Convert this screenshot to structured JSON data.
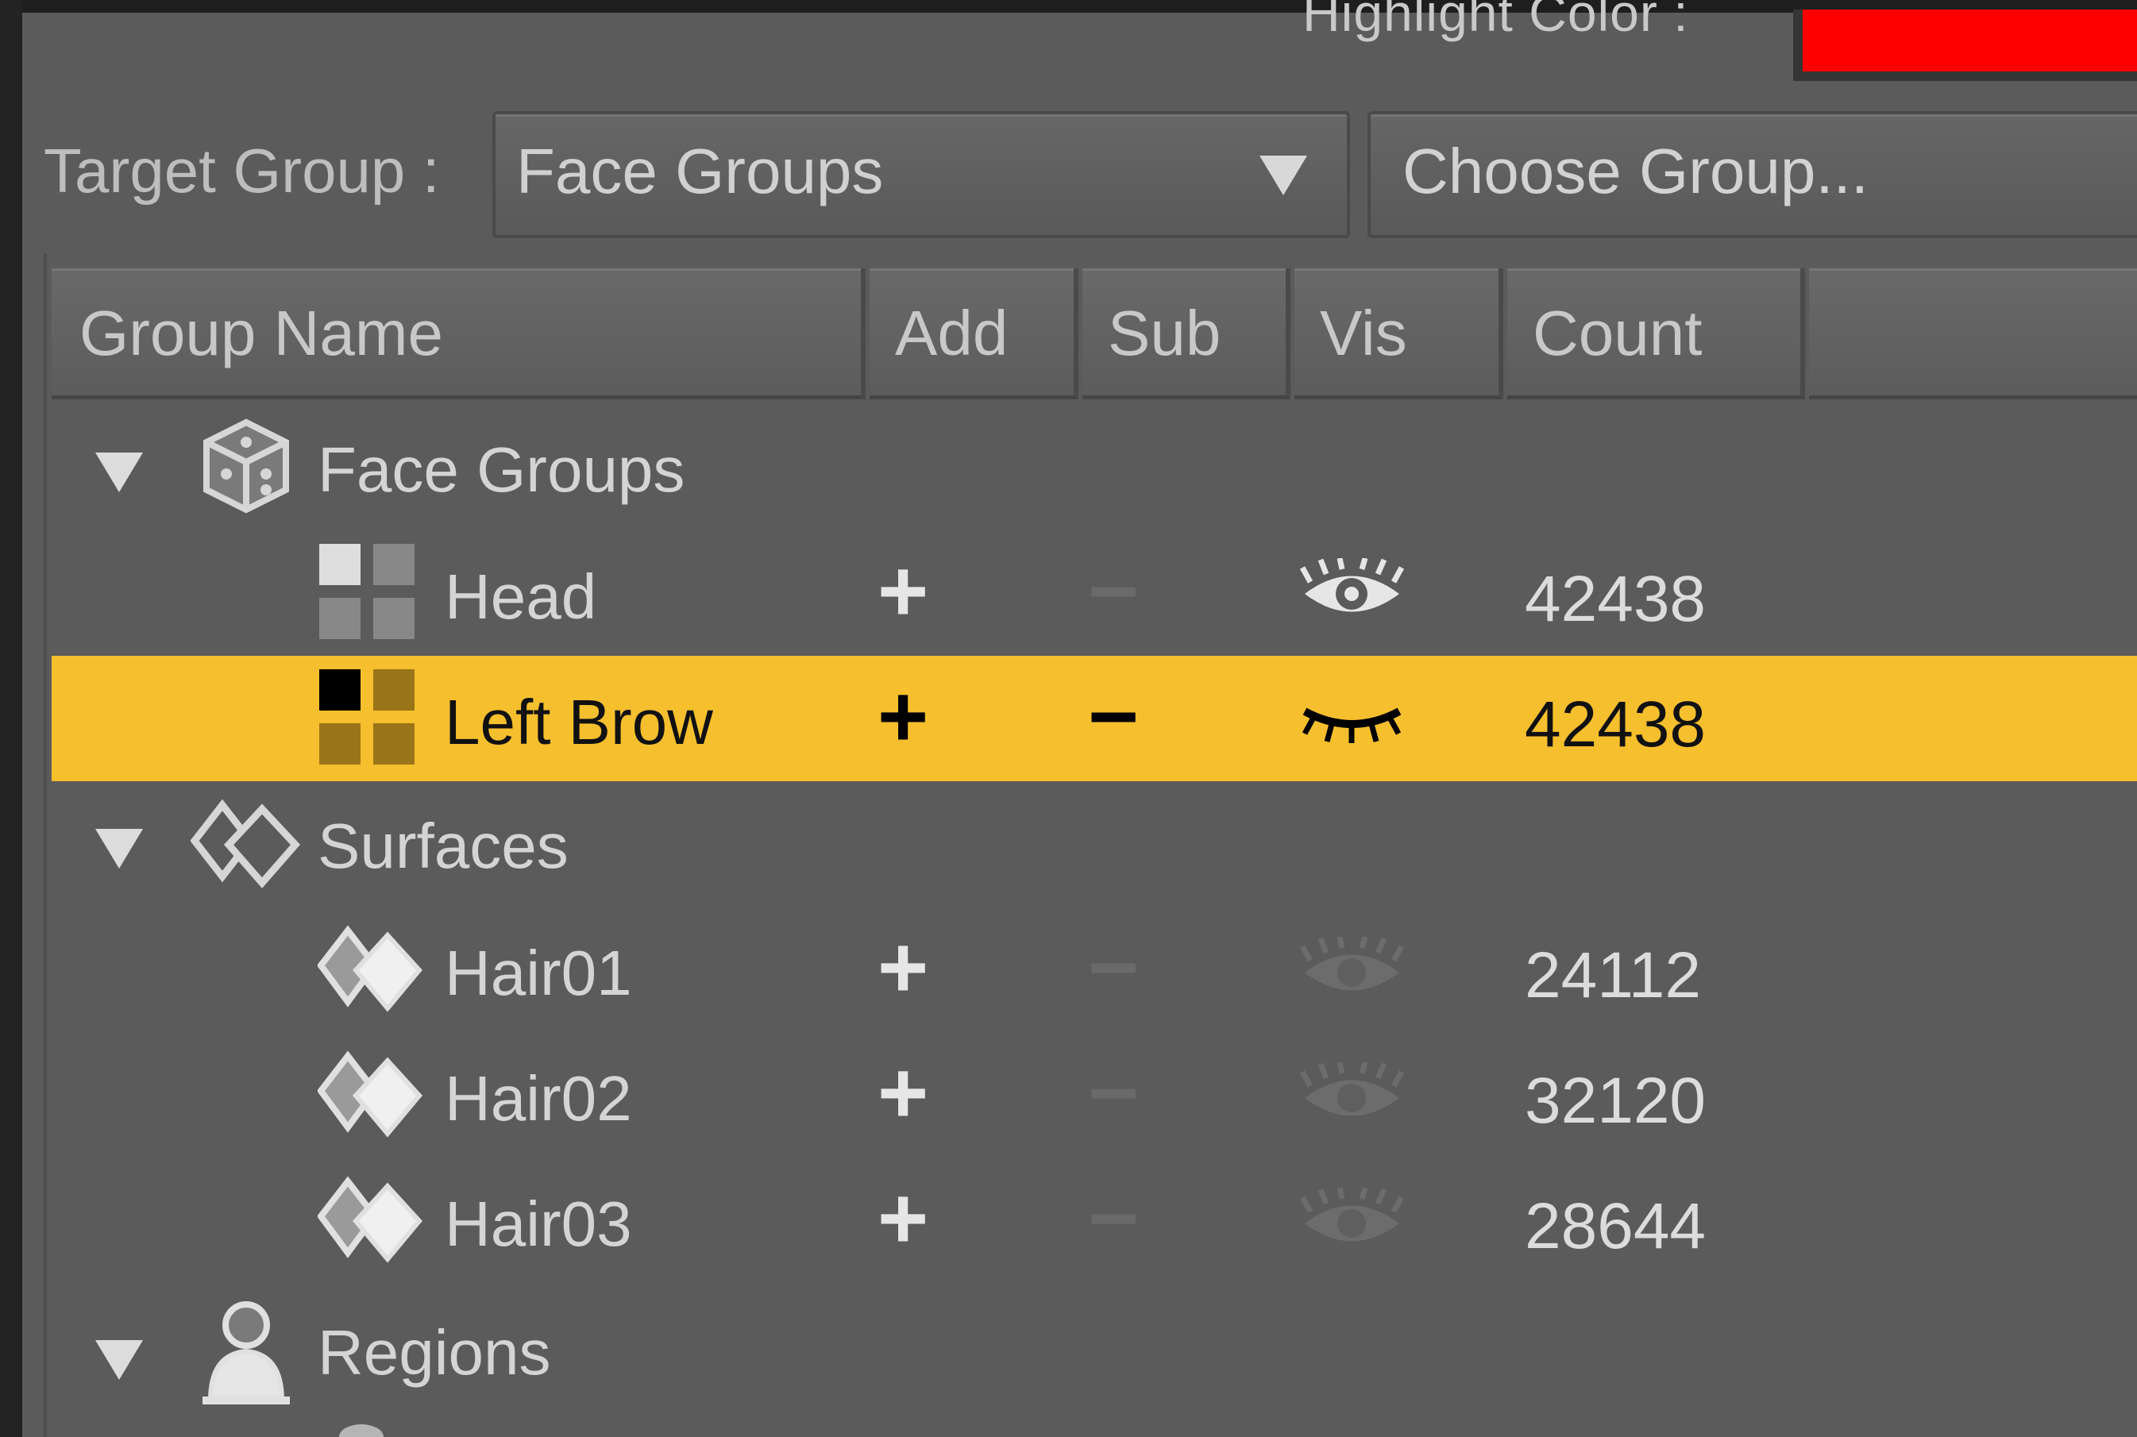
{
  "highlight": {
    "label": "Highlight Color :",
    "color": "#ff0000"
  },
  "target_group": {
    "label": "Target Group :",
    "selected": "Face Groups",
    "choose_button": "Choose Group..."
  },
  "table": {
    "columns": [
      "Group Name",
      "Add",
      "Sub",
      "Vis",
      "Count"
    ],
    "categories": [
      {
        "name": "Face Groups",
        "icon": "cube-icon",
        "expanded": true
      },
      {
        "name": "Surfaces",
        "icon": "surfaces-icon",
        "expanded": true
      },
      {
        "name": "Regions",
        "icon": "figure-icon",
        "expanded": true
      }
    ],
    "rows": [
      {
        "name": "Head",
        "add": "+",
        "sub": "−",
        "count": "42438",
        "icon": "face-group-icon",
        "visible": true,
        "selected": false
      },
      {
        "name": "Left Brow",
        "add": "+",
        "sub": "−",
        "count": "42438",
        "icon": "face-group-icon",
        "visible": false,
        "selected": true
      },
      {
        "name": "Hair01",
        "add": "+",
        "sub": "−",
        "count": "24112",
        "icon": "surface-icon",
        "visible": false,
        "selected": false
      },
      {
        "name": "Hair02",
        "add": "+",
        "sub": "−",
        "count": "32120",
        "icon": "surface-icon",
        "visible": false,
        "selected": false
      },
      {
        "name": "Hair03",
        "add": "+",
        "sub": "−",
        "count": "28644",
        "icon": "surface-icon",
        "visible": false,
        "selected": false
      }
    ],
    "selected_row_color": "#f6bf2d"
  }
}
